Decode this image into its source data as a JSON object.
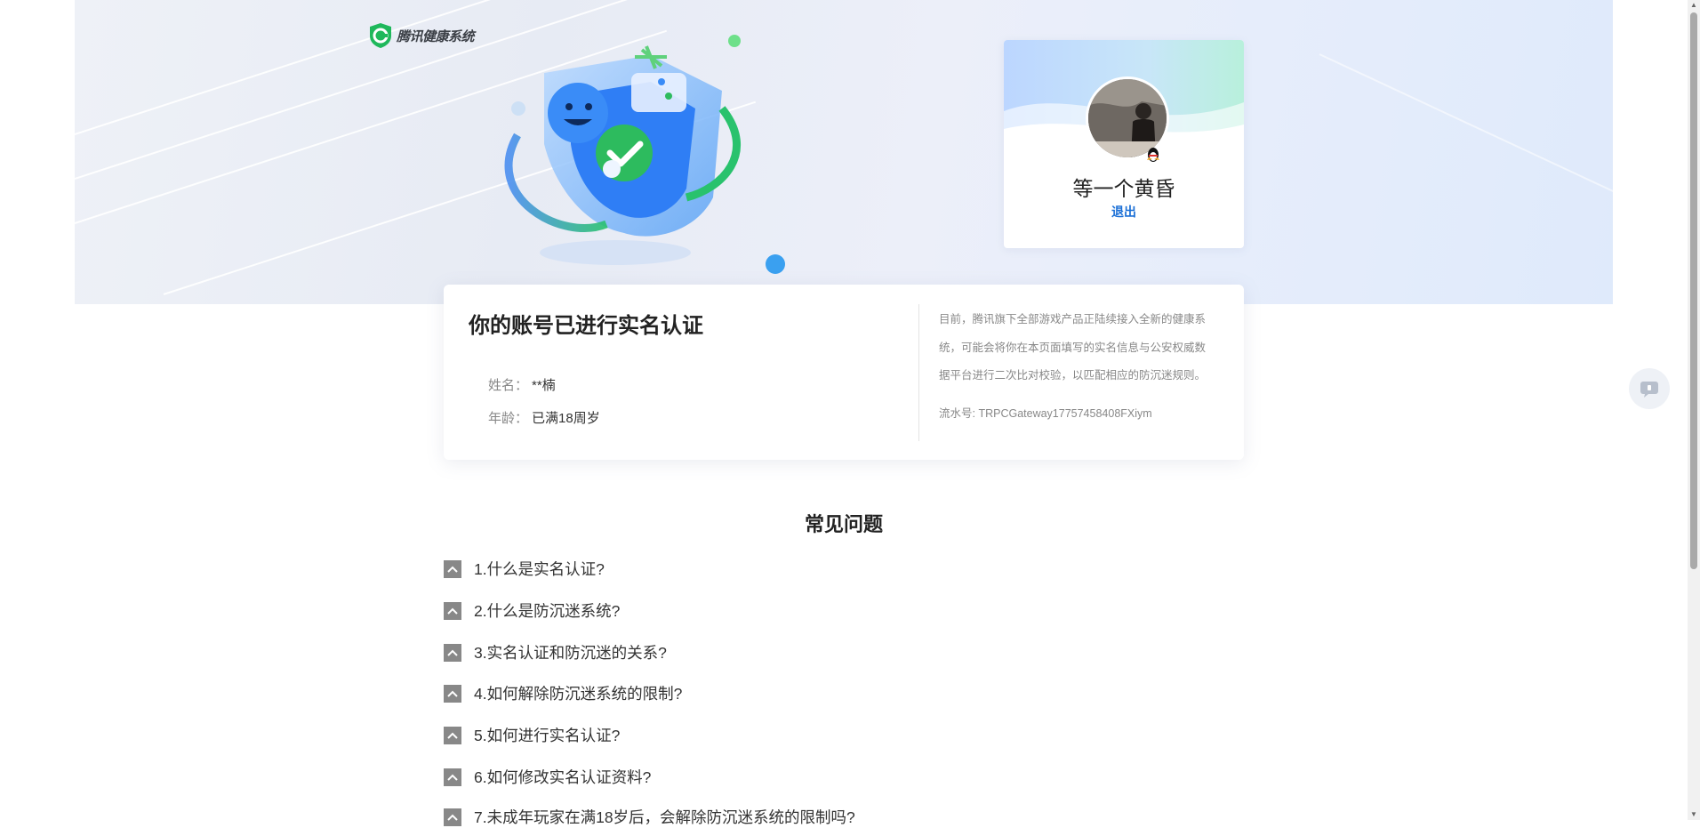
{
  "brand": {
    "name": "腾讯健康系统",
    "accent": "#1fb85b"
  },
  "user": {
    "nickname": "等一个黄昏",
    "logout_label": "退出"
  },
  "verification": {
    "title": "你的账号已进行实名认证",
    "name_label": "姓名：",
    "name_value": "**楠",
    "age_label": "年龄：",
    "age_value": "已满18周岁",
    "notice": "目前，腾讯旗下全部游戏产品正陆续接入全新的健康系统，可能会将你在本页面填写的实名信息与公安权威数据平台进行二次比对校验，以匹配相应的防沉迷规则。",
    "serial": "流水号: TRPCGateway17757458408FXiym"
  },
  "faq": {
    "title": "常见问题",
    "items": [
      "1.什么是实名认证?",
      "2.什么是防沉迷系统?",
      "3.实名认证和防沉迷的关系?",
      "4.如何解除防沉迷系统的限制?",
      "5.如何进行实名认证?",
      "6.如何修改实名认证资料?",
      "7.未成年玩家在满18岁后，会解除防沉迷系统的限制吗?"
    ]
  },
  "side_button": {
    "icon": "feedback-icon"
  },
  "colors": {
    "link": "#1a6fd6",
    "faq_icon_bg": "#888888",
    "banner_bg": "#e9edf6"
  }
}
